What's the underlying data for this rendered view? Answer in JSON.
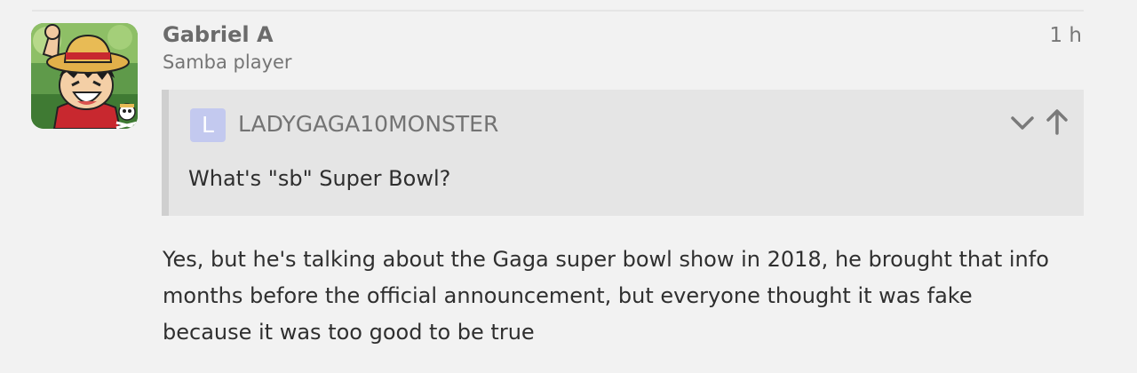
{
  "post": {
    "author_name": "Gabriel A",
    "author_title": "Samba player",
    "time": "1 h",
    "avatar_icon": "straw-hat-pirate-avatar-icon"
  },
  "quote": {
    "avatar_letter": "L",
    "avatar_color": "#c3c9ef",
    "username": "LADYGAGA10MONSTER",
    "text": "What's \"sb\" Super Bowl?",
    "expand_icon": "chevron-down-icon",
    "jump_icon": "arrow-up-icon"
  },
  "body": {
    "lines": [
      "Yes, but he's talking about the Gaga super bowl show in 2018, he brought that info",
      "months before the official announcement, but everyone thought it was fake",
      "because it was too good to be true"
    ]
  }
}
